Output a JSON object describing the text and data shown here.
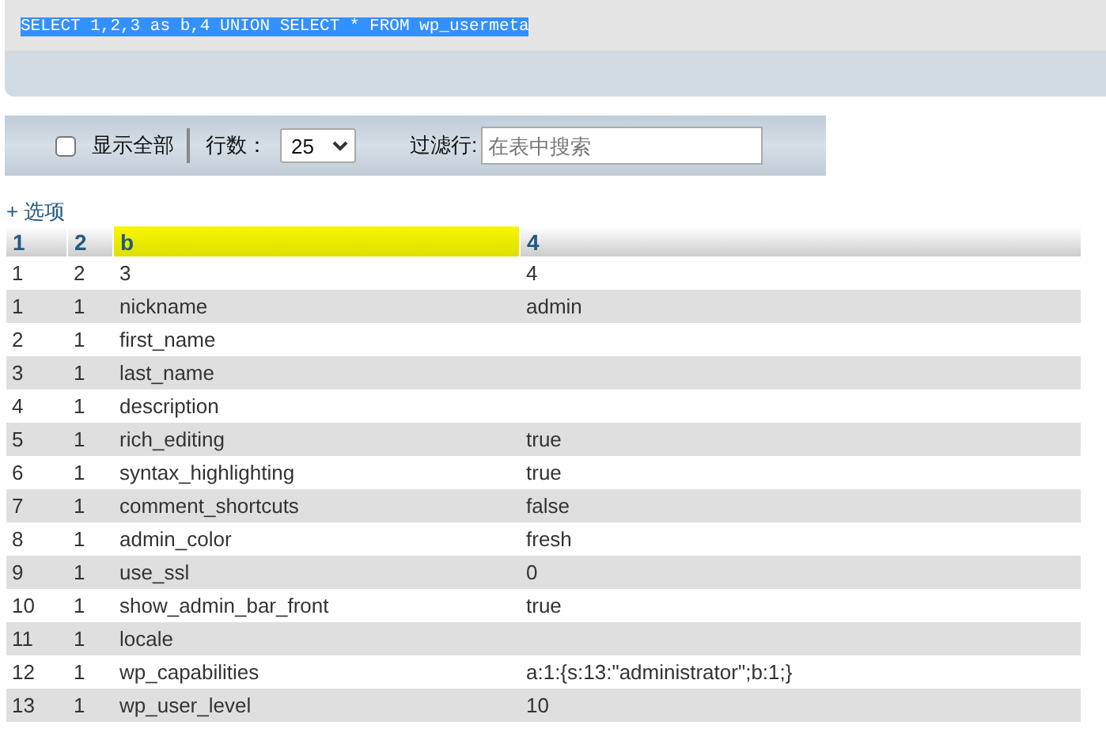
{
  "query": {
    "sql": "SELECT 1,2,3 as b,4 UNION SELECT * FROM wp_usermeta",
    "selected": true
  },
  "toolbar": {
    "show_all": {
      "label": "显示全部",
      "checked": false
    },
    "rows_label": "行数：",
    "rows_value": "25",
    "filter_label": "过滤行:",
    "filter_placeholder": "在表中搜索"
  },
  "options_link": "+ 选项",
  "table": {
    "columns": [
      {
        "label": "1",
        "highlighted": false
      },
      {
        "label": "2",
        "highlighted": false
      },
      {
        "label": "b",
        "highlighted": true
      },
      {
        "label": "4",
        "highlighted": false
      }
    ],
    "rows": [
      [
        "1",
        "2",
        "3",
        "4"
      ],
      [
        "1",
        "1",
        "nickname",
        "admin"
      ],
      [
        "2",
        "1",
        "first_name",
        ""
      ],
      [
        "3",
        "1",
        "last_name",
        ""
      ],
      [
        "4",
        "1",
        "description",
        ""
      ],
      [
        "5",
        "1",
        "rich_editing",
        "true"
      ],
      [
        "6",
        "1",
        "syntax_highlighting",
        "true"
      ],
      [
        "7",
        "1",
        "comment_shortcuts",
        "false"
      ],
      [
        "8",
        "1",
        "admin_color",
        "fresh"
      ],
      [
        "9",
        "1",
        "use_ssl",
        "0"
      ],
      [
        "10",
        "1",
        "show_admin_bar_front",
        "true"
      ],
      [
        "11",
        "1",
        "locale",
        ""
      ],
      [
        "12",
        "1",
        "wp_capabilities",
        "a:1:{s:13:\"administrator\";b:1;}"
      ],
      [
        "13",
        "1",
        "wp_user_level",
        "10"
      ]
    ]
  }
}
